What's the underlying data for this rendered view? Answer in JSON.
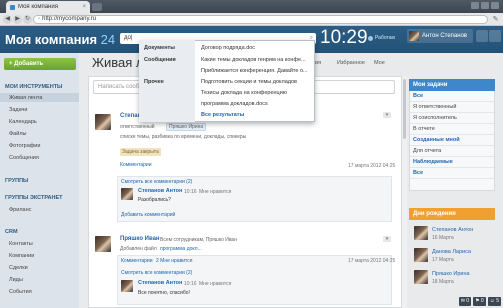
{
  "browser": {
    "tab_title": "Моя компания",
    "url": "http://mycompany.ru"
  },
  "header": {
    "logo": "Моя компания",
    "logo_num": "24",
    "search_value": "до|",
    "clock": "10:29",
    "work_status": "Работаю",
    "user_name": "Антон Степанов"
  },
  "search_dropdown": {
    "sections": [
      {
        "label": "Документы",
        "items": [
          "Договор подряда.doc"
        ]
      },
      {
        "label": "Сообщения",
        "items": [
          "Какие темы докладов генрим на конфе...",
          "Приближается конференция. Давайте о...",
          "Подготовить секции и темы докладов"
        ]
      },
      {
        "label": "Прочее",
        "items": [
          "Тезисы доклада на конференцию",
          "программа докладов.docs"
        ]
      }
    ],
    "all_results": "Все результаты"
  },
  "sidebar": {
    "add_label": "+ Добавить",
    "sections": [
      {
        "title": "Мои инструменты",
        "items": [
          "Живая лента",
          "Задачи",
          "Календарь",
          "Файлы",
          "Фотографии",
          "Сообщения"
        ]
      },
      {
        "title": "Группы",
        "items": []
      },
      {
        "title": "Группы экстранет",
        "items": [
          "Фриланс"
        ]
      },
      {
        "title": "CRM",
        "items": [
          "Контакты",
          "Компании",
          "Сделки",
          "Лиды",
          "События"
        ]
      }
    ]
  },
  "main": {
    "title": "Живая лента",
    "tabs": [
      "ния",
      "Избранное",
      "Мое"
    ],
    "send_placeholder": "Написать сообщ...",
    "posts": [
      {
        "author": "Степанов Антон",
        "recipient_prefix": "ответственный",
        "recipient": "Пряшко Ирина",
        "text": "списке темы, разбивка по времени, доклады, спикеры",
        "badge": "Задача закрыта",
        "comments_label": "Комментарии",
        "date": "17 марта 2012 04:25",
        "show_all": "Смотреть все комментарии (2)",
        "comment": {
          "author": "Степанов Антон",
          "time": "10:16",
          "likes": "Мне нравится",
          "text": "Разобрались?"
        },
        "add_comment": "Добавить комментарий"
      },
      {
        "author": "Пряшко Иван",
        "recipient": "Всем сотрудникам, Пряшко Иван",
        "files_prefix": "Добавлен файл",
        "file": "программа докл...",
        "comments_label": "Комментарии",
        "likes": "2 Мне нравится",
        "date": "17 марта 2012 04:25",
        "show_all": "Смотреть все комментарии (2)",
        "comment": {
          "author": "Степанов Антон",
          "time": "10:16",
          "likes": "Мне нравится",
          "text": "Все понятно, спасибо!"
        }
      }
    ]
  },
  "tasks": {
    "title": "Мои задачи",
    "rows": [
      {
        "label": "Все",
        "bold": true
      },
      {
        "label": "Я ответственный",
        "bold": false
      },
      {
        "label": "Я соисполнитель",
        "bold": false
      },
      {
        "label": "В отчете",
        "bold": false
      },
      {
        "label": "Созданные мной",
        "bold": true
      },
      {
        "label": "Для отчета",
        "bold": false
      },
      {
        "label": "Наблюдаемые",
        "bold": true
      },
      {
        "label": "Все",
        "bold": true
      }
    ]
  },
  "birthdays": {
    "title": "Дни рождения",
    "people": [
      {
        "name": "Степанов Антон",
        "date": "16 Марта"
      },
      {
        "name": "Данова Лариса",
        "date": "17 Марта"
      },
      {
        "name": "Пряшко Ирина",
        "date": "18 Марта"
      }
    ]
  },
  "colors": {
    "header": "#2b5d86",
    "accent": "#3e87c9",
    "add": "#8bc34a",
    "birthday": "#f0a030"
  }
}
